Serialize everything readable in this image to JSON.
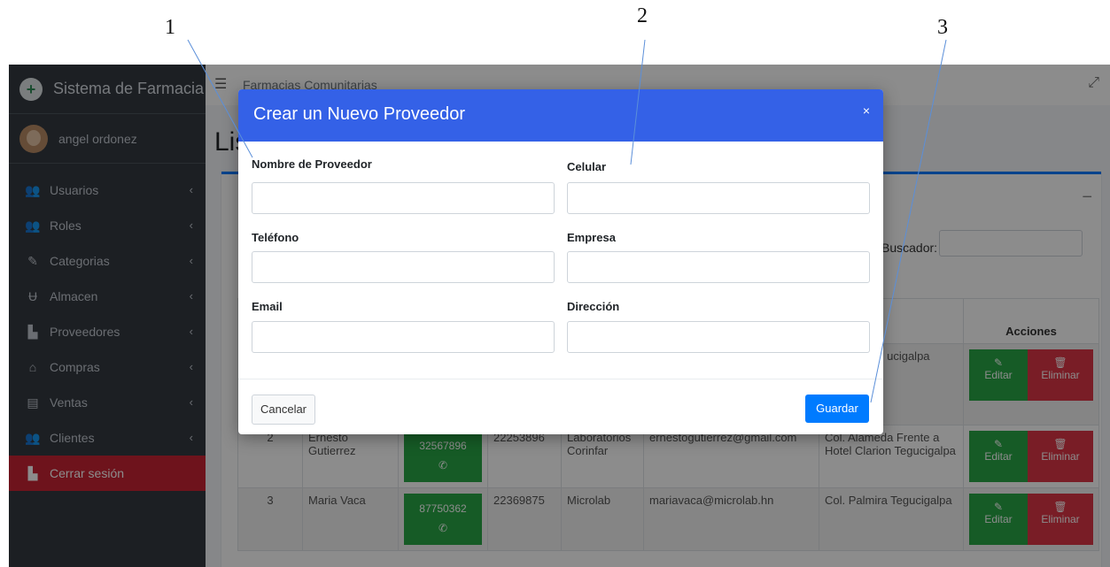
{
  "annotations": [
    "1",
    "2",
    "3"
  ],
  "sidebar": {
    "brand": "Sistema de Farmacia",
    "user": "angel ordonez",
    "items": [
      {
        "label": "Usuarios",
        "icon": "users-icon"
      },
      {
        "label": "Roles",
        "icon": "roles-icon"
      },
      {
        "label": "Categorias",
        "icon": "categories-icon"
      },
      {
        "label": "Almacen",
        "icon": "warehouse-icon"
      },
      {
        "label": "Proveedores",
        "icon": "factory-icon"
      },
      {
        "label": "Compras",
        "icon": "basket-icon"
      },
      {
        "label": "Ventas",
        "icon": "register-icon"
      },
      {
        "label": "Clientes",
        "icon": "clients-icon"
      }
    ],
    "logout": "Cerrar sesión"
  },
  "topbar": {
    "title": "Farmacias Comunitarias"
  },
  "page": {
    "title": "Lis"
  },
  "search": {
    "label": "Buscador:"
  },
  "table": {
    "headers": [
      "",
      "",
      "",
      "",
      "",
      "",
      "ón",
      "Acciones"
    ],
    "rows": [
      {
        "num": "",
        "name": "",
        "phone": "",
        "tel": "",
        "company": "",
        "email": "",
        "address": "ica aun nes ucigalpa"
      },
      {
        "num": "2",
        "name": "Ernesto Gutierrez",
        "phone": "32567896",
        "tel": "22253896",
        "company": "Laboratorios Corinfar",
        "email": "ernestogutierrez@gmail.com",
        "address": "Col. Alameda Frente a Hotel Clarion Tegucigalpa"
      },
      {
        "num": "3",
        "name": "Maria Vaca",
        "phone": "87750362",
        "tel": "22369875",
        "company": "Microlab",
        "email": "mariavaca@microlab.hn",
        "address": "Col. Palmira Tegucigalpa"
      }
    ],
    "edit_label": "Editar",
    "delete_label": "Eliminar"
  },
  "modal": {
    "title": "Crear un Nuevo Proveedor",
    "close": "×",
    "fields": {
      "nombre": "Nombre de Proveedor",
      "celular": "Celular",
      "telefono": "Teléfono",
      "empresa": "Empresa",
      "email": "Email",
      "direccion": "Dirección"
    },
    "cancel": "Cancelar",
    "save": "Guardar"
  }
}
